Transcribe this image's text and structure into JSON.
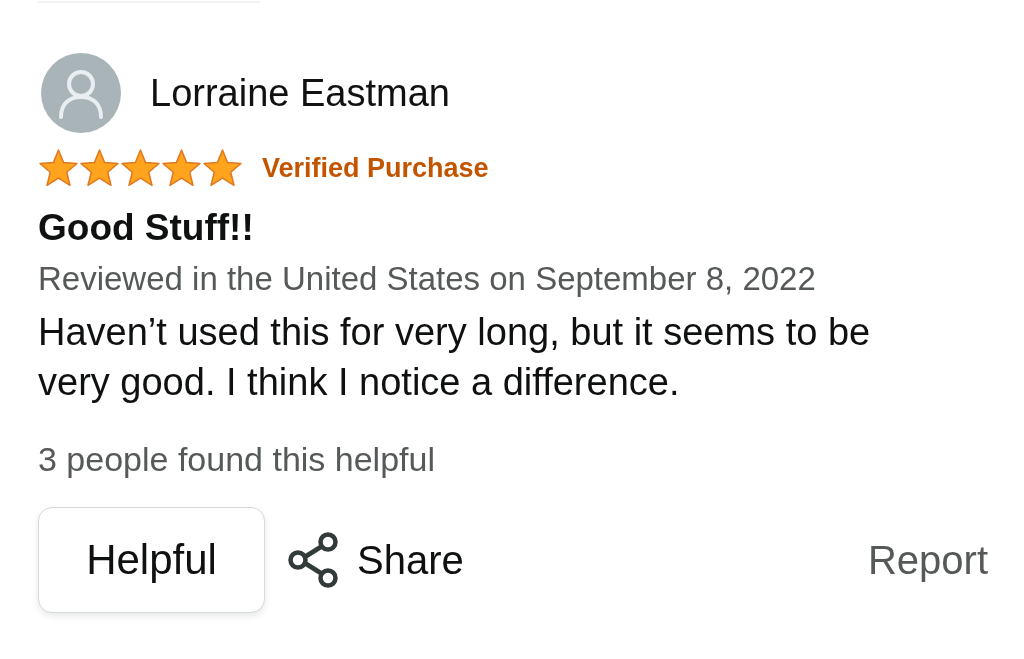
{
  "review": {
    "reviewer": {
      "name": "Lorraine Eastman"
    },
    "stars": 5,
    "badge": "Verified Purchase",
    "title": "Good Stuff!!",
    "meta": "Reviewed in the United States on September 8, 2022",
    "body": "Haven’t used this for very long, but it seems to be very good. I think I notice a difference.",
    "helpful_count": "3 people found this helpful",
    "actions": [
      {
        "kind": "button",
        "label": "Helpful"
      },
      {
        "kind": "share",
        "label": "Share"
      },
      {
        "kind": "link",
        "label": "Report"
      }
    ]
  }
}
